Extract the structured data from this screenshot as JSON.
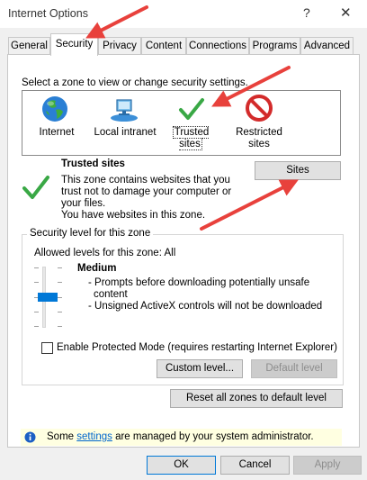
{
  "window": {
    "title": "Internet Options",
    "help": "?",
    "close": "✕"
  },
  "tabs": [
    "General",
    "Security",
    "Privacy",
    "Content",
    "Connections",
    "Programs",
    "Advanced"
  ],
  "security": {
    "select_zone_text": "Select a zone to view or change security settings.",
    "zones": [
      {
        "label": "Internet",
        "icon": "globe-icon"
      },
      {
        "label": "Local intranet",
        "icon": "intranet-icon"
      },
      {
        "label": "Trusted sites",
        "icon": "checkmark-icon"
      },
      {
        "label_line1": "Restricted",
        "label_line2": "sites",
        "icon": "restricted-icon"
      }
    ],
    "zone_info": {
      "title": "Trusted sites",
      "line1": "This zone contains websites that you",
      "line2": "trust not to damage your computer or",
      "line3": "your files.",
      "line4": "You have websites in this zone."
    },
    "sites_button": "Sites",
    "level_group": {
      "title": "Security level for this zone",
      "allowed": "Allowed levels for this zone: All",
      "level_name": "Medium",
      "bullet1a": "- Prompts before downloading potentially unsafe",
      "bullet1b": "content",
      "bullet2": "- Unsigned ActiveX controls will not be downloaded",
      "slider_level_index": 2,
      "slider_levels": 5
    },
    "protected_mode": {
      "label": "Enable Protected Mode (requires restarting Internet Explorer)",
      "checked": false
    },
    "custom_level_button": "Custom level...",
    "default_level_button": "Default level",
    "reset_all_button": "Reset all zones to default level",
    "info": {
      "prefix": "Some ",
      "link": "settings",
      "suffix": " are managed by your system administrator."
    }
  },
  "dialog_buttons": {
    "ok": "OK",
    "cancel": "Cancel",
    "apply": "Apply"
  },
  "colors": {
    "accent": "#0078d7",
    "annotation_arrow": "#e8413c",
    "info_bar": "#ffffe1"
  }
}
